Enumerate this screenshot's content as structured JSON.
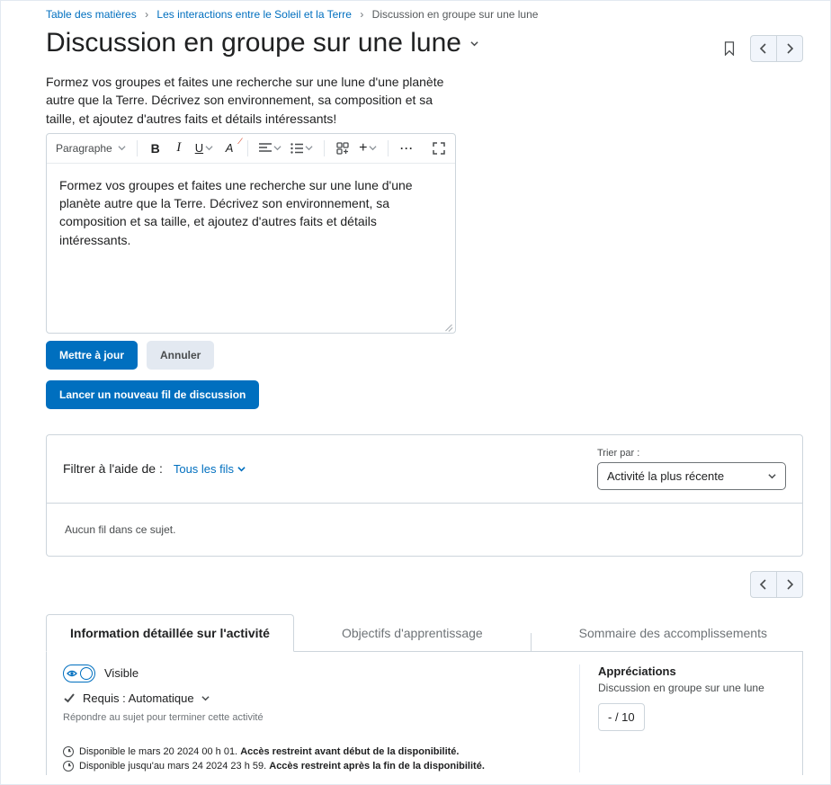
{
  "breadcrumb": {
    "a": "Table des matières",
    "b": "Les interactions entre le Soleil et la Terre",
    "c": "Discussion en groupe sur une lune"
  },
  "title": "Discussion en groupe sur une lune",
  "intro": "Formez vos groupes et faites une recherche sur une lune d'une planète autre que la Terre. Décrivez son environnement, sa composition et sa taille, et ajoutez d'autres faits et détails intéressants!",
  "editor": {
    "para_label": "Paragraphe",
    "body_text": "Formez vos groupes et faites une recherche sur une lune d'une planète autre que la Terre. Décrivez son environnement, sa composition et sa taille, et ajoutez d'autres faits et détails intéressants."
  },
  "buttons": {
    "update": "Mettre à jour",
    "cancel": "Annuler",
    "new_thread": "Lancer un nouveau fil de discussion"
  },
  "filter": {
    "label": "Filtrer à l'aide de :",
    "all_threads": "Tous les fils",
    "sort_label": "Trier par :",
    "sort_value": "Activité la plus récente",
    "empty": "Aucun fil dans ce sujet."
  },
  "tabs": {
    "a": "Information détaillée sur l'activité",
    "b": "Objectifs d'apprentissage",
    "c": "Sommaire des accomplissements"
  },
  "details": {
    "visible": "Visible",
    "required": "Requis : Automatique",
    "completion_hint": "Répondre au sujet pour terminer cette activité",
    "avail1_a": "Disponible le mars 20 2024 00 h 01.",
    "avail1_b": "Accès restreint avant début de la disponibilité.",
    "avail2_a": "Disponible jusqu'au mars 24 2024 23 h 59.",
    "avail2_b": "Accès restreint après la fin de la disponibilité.",
    "appr_header": "Appréciations",
    "appr_sub": "Discussion en groupe sur une lune",
    "score": "- / 10"
  }
}
